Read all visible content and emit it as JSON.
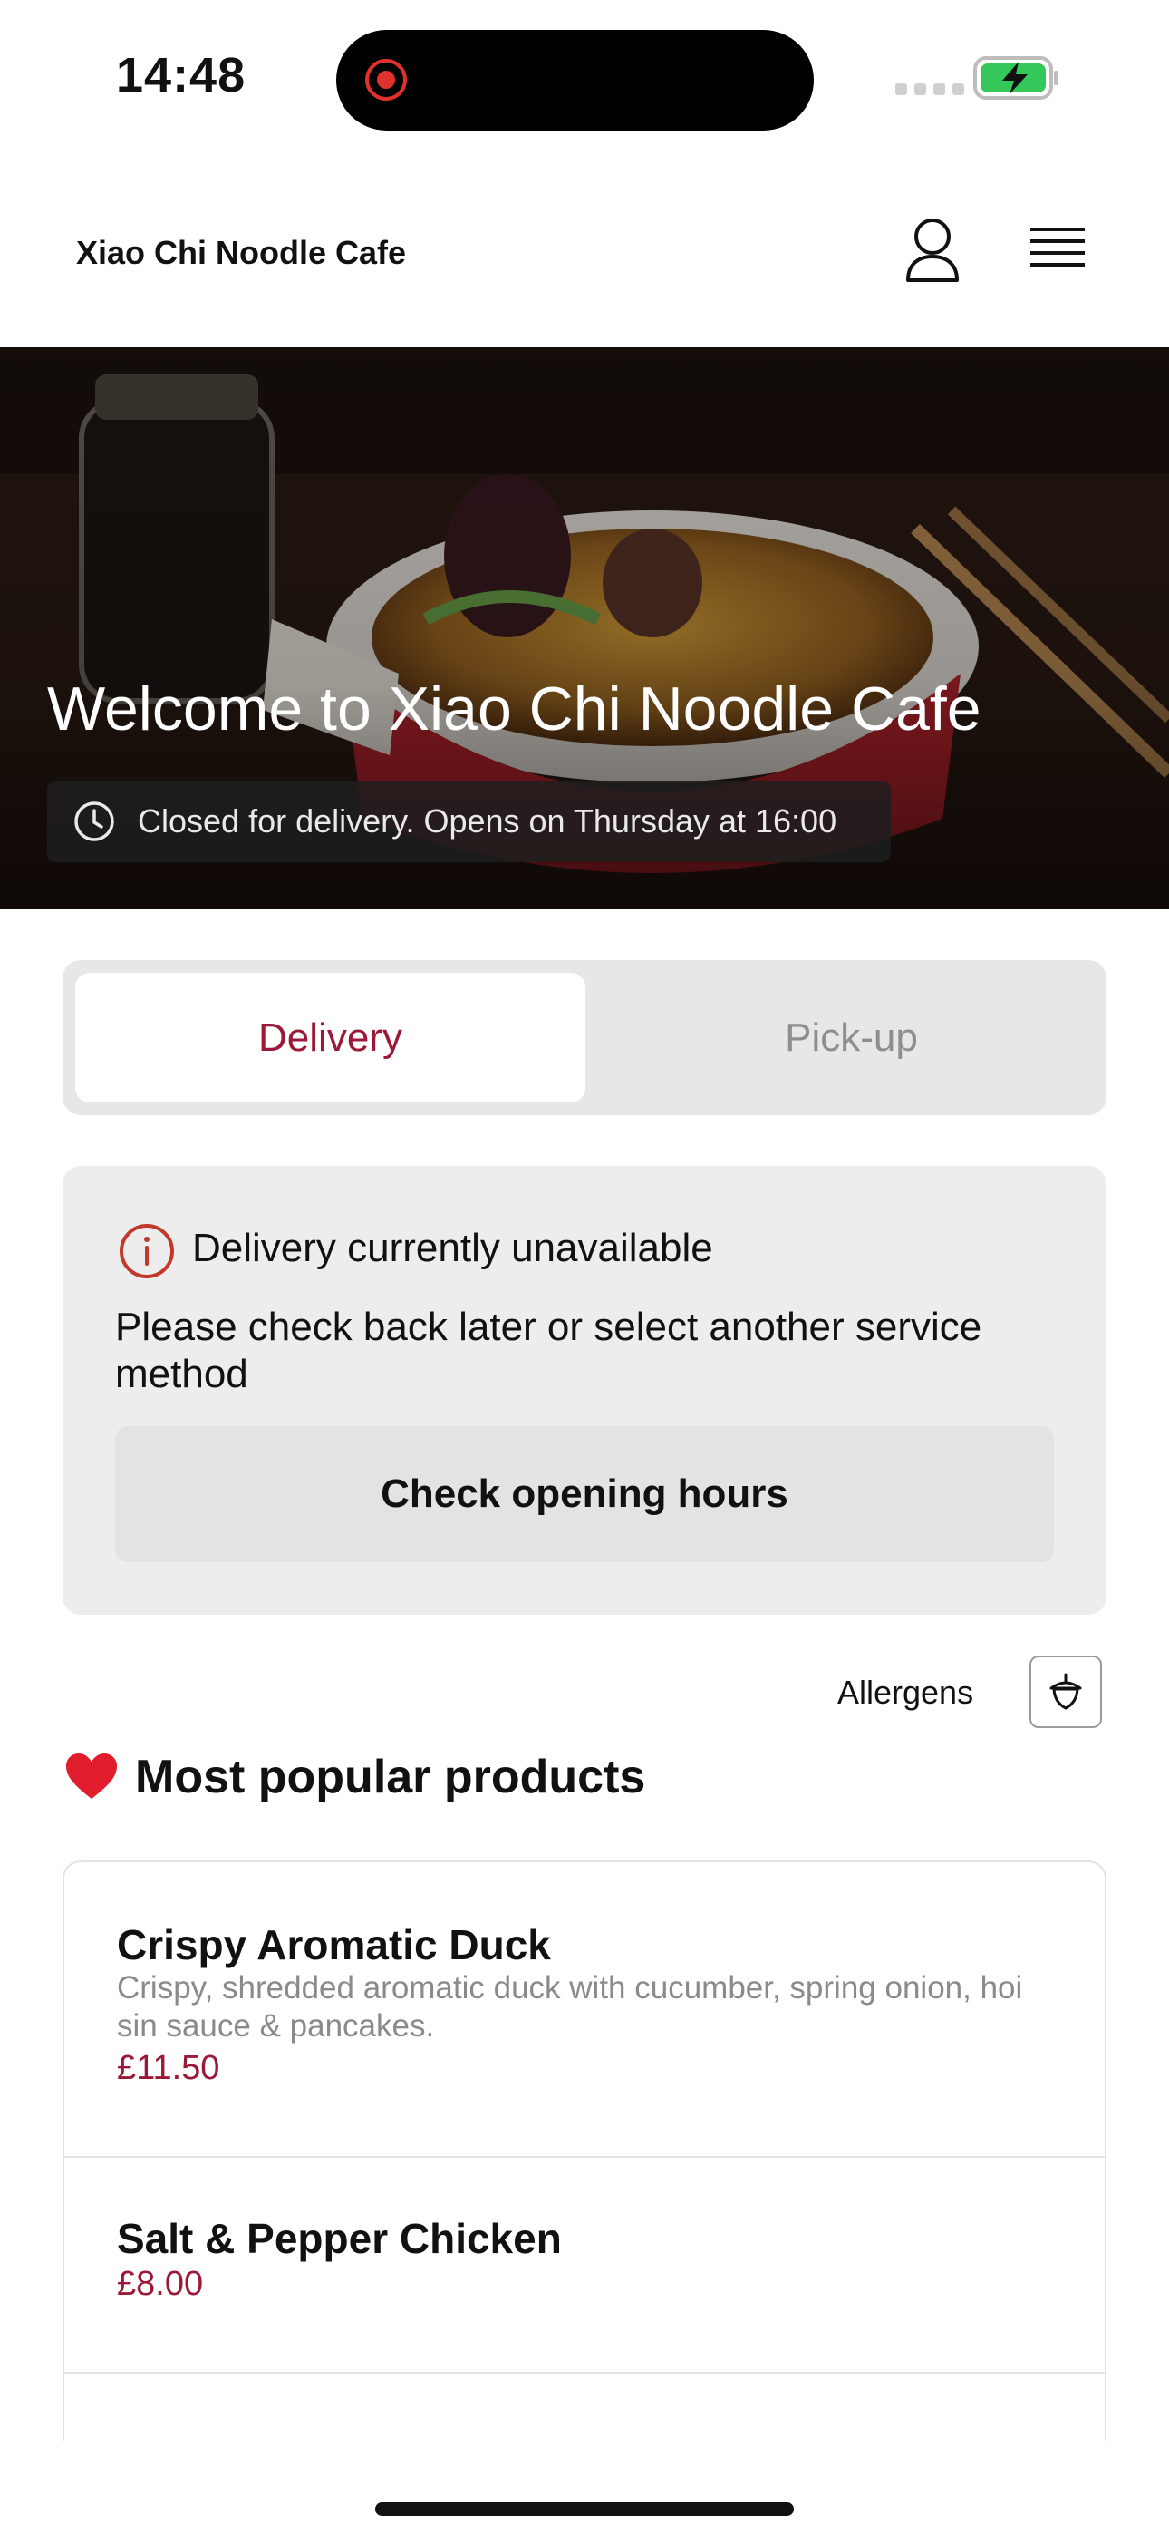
{
  "status_bar": {
    "time": "14:48"
  },
  "header": {
    "brand": "Xiao Chi Noodle Cafe",
    "user_icon": "user-icon",
    "menu_icon": "hamburger-menu-icon"
  },
  "hero": {
    "title": "Welcome to Xiao Chi Noodle Cafe",
    "status": "Closed for delivery. Opens on Thursday at 16:00"
  },
  "service_tabs": {
    "delivery": "Delivery",
    "pickup": "Pick-up",
    "selected": "delivery"
  },
  "notice": {
    "title": "Delivery currently unavailable",
    "body": "Please check back later or select another service method",
    "button": "Check opening hours"
  },
  "allergens": {
    "label": "Allergens",
    "icon": "acorn-icon"
  },
  "section": {
    "title": "Most popular products",
    "icon": "red-heart-icon"
  },
  "products": [
    {
      "name": "Crispy Aromatic Duck",
      "description": "Crispy, shredded aromatic duck with cucumber, spring onion, hoi sin sauce & pancakes.",
      "price": "£11.50"
    },
    {
      "name": "Salt & Pepper Chicken",
      "description": "",
      "price": "£8.00"
    }
  ],
  "colors": {
    "accent": "#9b1937",
    "notice_bg": "#ededed",
    "battery": "#34c759"
  }
}
